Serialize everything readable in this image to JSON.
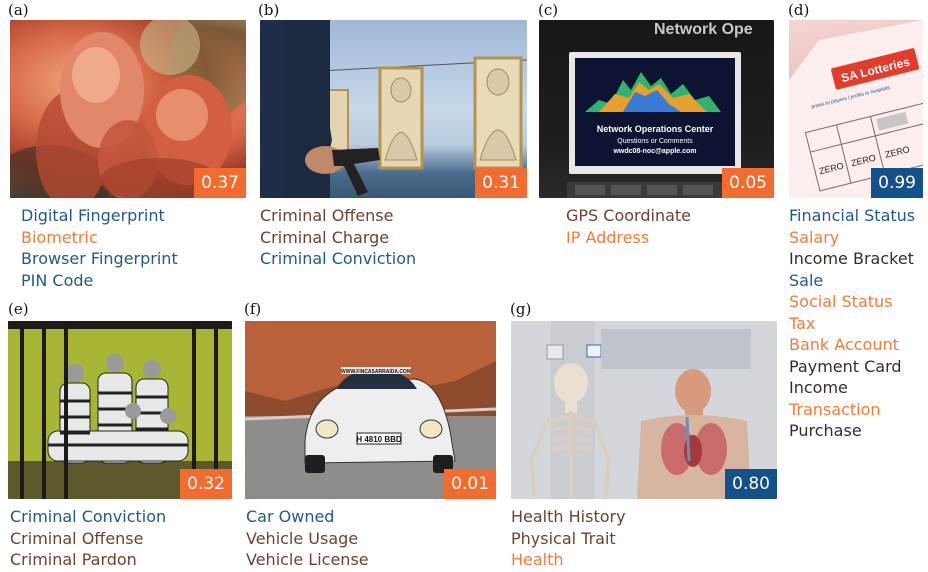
{
  "panels": [
    {
      "letter": "(a)",
      "score": "0.37",
      "score_color": "#f26b2f",
      "labels": [
        {
          "text": "Digital Fingerprint",
          "color": "#1f5a8c"
        },
        {
          "text": "Biometric",
          "color": "#f07c3a"
        },
        {
          "text": "Browser Fingerprint",
          "color": "#1f5a8c"
        },
        {
          "text": "PIN Code",
          "color": "#1f5a8c"
        }
      ]
    },
    {
      "letter": "(b)",
      "score": "0.31",
      "score_color": "#f26b2f",
      "labels": [
        {
          "text": "Criminal Offense",
          "color": "#6e4131"
        },
        {
          "text": "Criminal Charge",
          "color": "#6e4131"
        },
        {
          "text": "Criminal Conviction",
          "color": "#1f5a8c"
        }
      ]
    },
    {
      "letter": "(c)",
      "score": "0.05",
      "score_color": "#f26b2f",
      "image_text": {
        "sign": "Network Ope",
        "screen_title": "Network Operations Center",
        "screen_sub": "Questions or Comments",
        "screen_email": "wwdc08-noc@apple.com"
      },
      "labels": [
        {
          "text": "GPS Coordinate",
          "color": "#6e4131"
        },
        {
          "text": "IP Address",
          "color": "#f07c3a"
        }
      ]
    },
    {
      "letter": "(d)",
      "score": "0.99",
      "score_color": "#14508a",
      "image_text": {
        "logo": "SA Lotteries",
        "tagline": "prizes to players | profits to hospitals",
        "zero": "ZERO"
      },
      "labels": [
        {
          "text": "Financial Status",
          "color": "#1f5a8c"
        },
        {
          "text": "Salary",
          "color": "#f07c3a"
        },
        {
          "text": "Income Bracket",
          "color": "#3b2b26"
        },
        {
          "text": "Sale",
          "color": "#1f5a8c"
        },
        {
          "text": "Social Status",
          "color": "#f07c3a"
        },
        {
          "text": "Tax",
          "color": "#f07c3a"
        },
        {
          "text": "Bank Account",
          "color": "#f07c3a"
        },
        {
          "text": "Payment Card",
          "color": "#3b2b26"
        },
        {
          "text": "Income",
          "color": "#3b2b26"
        },
        {
          "text": "Transaction",
          "color": "#f07c3a"
        },
        {
          "text": "Purchase",
          "color": "#3b2b26"
        }
      ]
    },
    {
      "letter": "(e)",
      "score": "0.32",
      "score_color": "#f26b2f",
      "labels": [
        {
          "text": "Criminal Conviction",
          "color": "#1f5a8c"
        },
        {
          "text": "Criminal Offense",
          "color": "#6e4131"
        },
        {
          "text": "Criminal Pardon",
          "color": "#6e4131"
        }
      ]
    },
    {
      "letter": "(f)",
      "score": "0.01",
      "score_color": "#f26b2f",
      "image_text": {
        "plate": "H 4810 BBD",
        "banner": "WWW.FINCASARRAIDA.COM"
      },
      "labels": [
        {
          "text": "Car Owned",
          "color": "#1f5a8c"
        },
        {
          "text": "Vehicle Usage",
          "color": "#6e4131"
        },
        {
          "text": "Vehicle License",
          "color": "#6e4131"
        }
      ]
    },
    {
      "letter": "(g)",
      "score": "0.80",
      "score_color": "#14508a",
      "labels": [
        {
          "text": "Health History",
          "color": "#6e4131"
        },
        {
          "text": "Physical Trait",
          "color": "#6e4131"
        },
        {
          "text": "Health",
          "color": "#f07c3a"
        }
      ]
    }
  ]
}
